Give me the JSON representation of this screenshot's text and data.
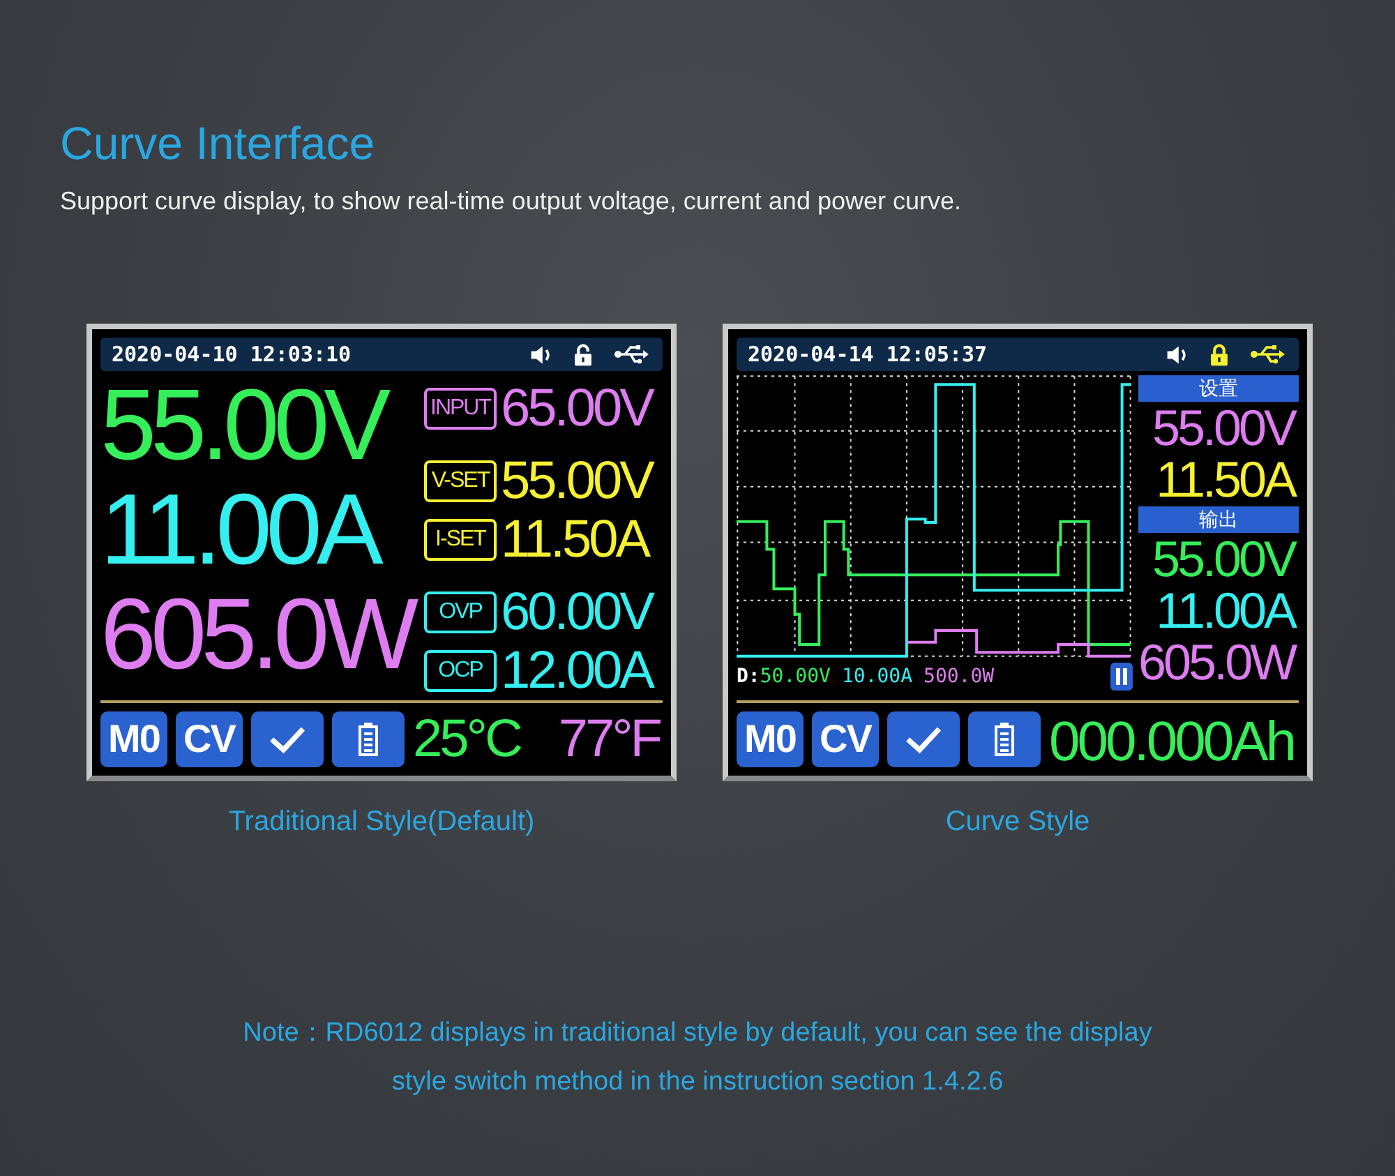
{
  "header": {
    "title": "Curve Interface",
    "subtitle": "Support curve display, to show real-time output voltage, current and power curve."
  },
  "screens": [
    {
      "kind": "traditional",
      "datetime": "2020-04-10 12:03:10",
      "locked": false,
      "readings": [
        {
          "text": "55.00V",
          "color": "#35ee5a"
        },
        {
          "text": "11.00A",
          "color": "#35eef0"
        },
        {
          "text": "605.0W",
          "color": "#dd7df0"
        }
      ],
      "param_groups": [
        {
          "params": [
            {
              "label": "INPUT",
              "value": "65.00V",
              "color": "#dd7df0"
            }
          ]
        },
        {
          "params": [
            {
              "label": "V-SET",
              "value": "55.00V",
              "color": "#f5f032"
            },
            {
              "label": "I-SET",
              "value": "11.50A",
              "color": "#f5f032"
            }
          ]
        },
        {
          "params": [
            {
              "label": "OVP",
              "value": "60.00V",
              "color": "#35eef0"
            },
            {
              "label": "OCP",
              "value": "12.00A",
              "color": "#35eef0"
            }
          ]
        }
      ],
      "badges": [
        "M0",
        "CV"
      ],
      "footer_values": [
        {
          "text": "25°C",
          "color": "#35ee5a"
        },
        {
          "text": "77°F",
          "color": "#dd7df0"
        }
      ],
      "caption": "Traditional Style(Default)"
    },
    {
      "kind": "curve",
      "datetime": "2020-04-14 12:05:37",
      "locked": true,
      "scale_label": "D:",
      "scales": [
        {
          "text": "50.00V",
          "color": "#35ee5a"
        },
        {
          "text": "10.00A",
          "color": "#35eef0"
        },
        {
          "text": "500.0W",
          "color": "#dd7df0"
        }
      ],
      "side_sections": [
        {
          "heading": "设置",
          "values": [
            {
              "text": "55.00V",
              "color": "#dd7df0"
            },
            {
              "text": "11.50A",
              "color": "#f5f032"
            }
          ]
        },
        {
          "heading": "输出",
          "values": [
            {
              "text": "55.00V",
              "color": "#35ee5a"
            },
            {
              "text": "11.00A",
              "color": "#35eef0"
            },
            {
              "text": "605.0W",
              "color": "#dd7df0"
            }
          ]
        }
      ],
      "badges": [
        "M0",
        "CV"
      ],
      "footer_values": [
        {
          "text": "000.000Ah",
          "color": "#35ee5a"
        }
      ],
      "caption": "Curve Style"
    }
  ],
  "note": [
    "Note：RD6012 displays in traditional style by default, you can see the display",
    "style switch method in the instruction section 1.4.2.6"
  ]
}
